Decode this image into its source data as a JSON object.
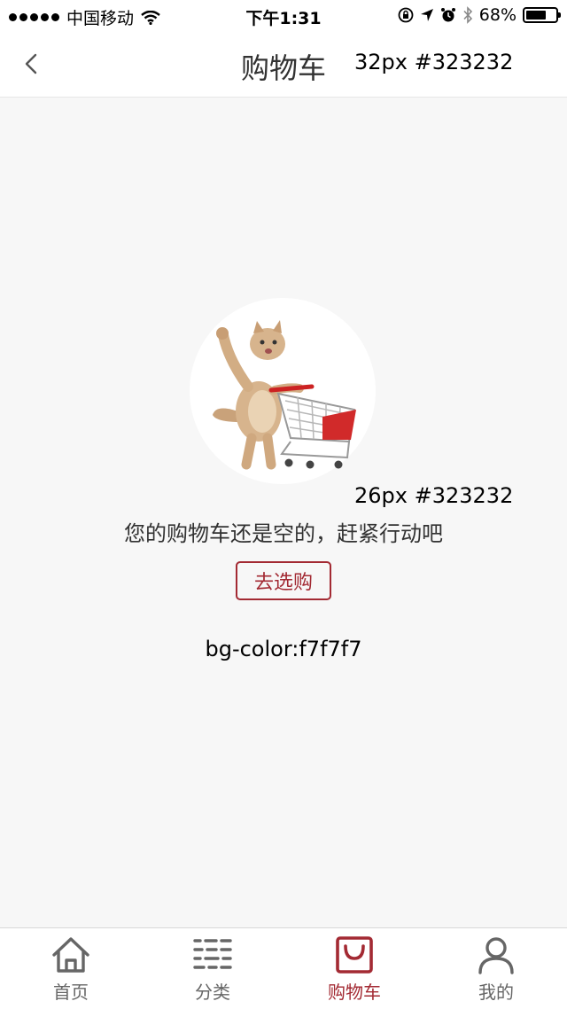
{
  "status_bar": {
    "carrier": "中国移动",
    "time": "下午1:31",
    "battery_percent": "68%",
    "battery_level": 0.68,
    "icons": [
      "signal-dots-icon",
      "wifi-icon",
      "orientation-lock-icon",
      "location-arrow-icon",
      "alarm-icon",
      "bluetooth-icon",
      "battery-icon"
    ]
  },
  "nav_bar": {
    "back_icon": "chevron-left-icon",
    "title": "购物车",
    "annotation": "32px #323232"
  },
  "empty_cart": {
    "illustration": "cat-pushing-shopping-cart",
    "annotation": "26px #323232",
    "message": "您的购物车还是空的，赶紧行动吧",
    "button_label": "去选购",
    "bg_annotation": "bg-color:f7f7f7"
  },
  "tab_bar": {
    "tabs": [
      {
        "label": "首页",
        "icon": "home-icon",
        "active": false
      },
      {
        "label": "分类",
        "icon": "category-list-icon",
        "active": false
      },
      {
        "label": "购物车",
        "icon": "shopping-bag-icon",
        "active": true
      },
      {
        "label": "我的",
        "icon": "user-icon",
        "active": false
      }
    ]
  },
  "colors": {
    "text": "#323232",
    "page_background": "#f7f7f7",
    "accent": "#a32a33",
    "tab_inactive": "#666666"
  }
}
